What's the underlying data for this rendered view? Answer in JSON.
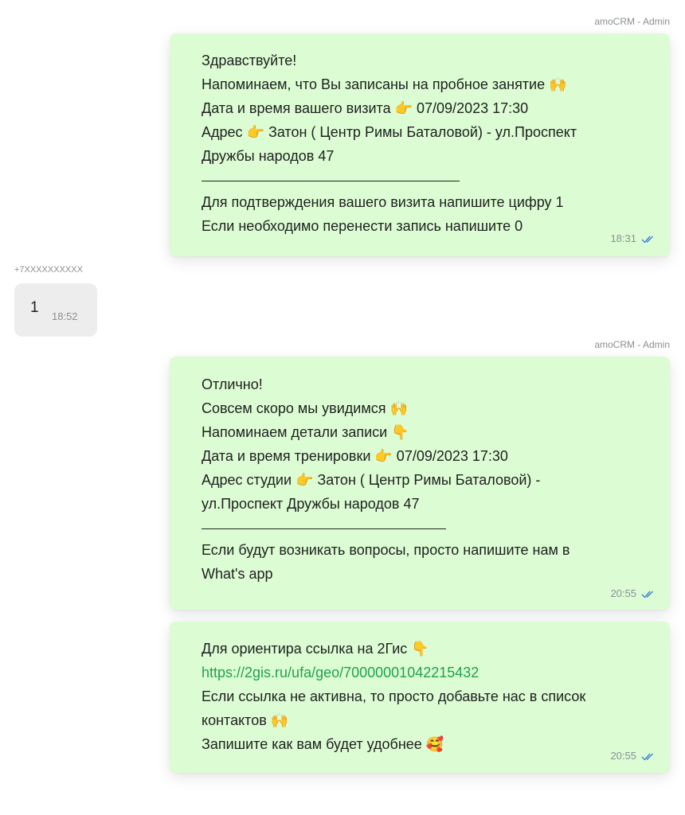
{
  "messages": [
    {
      "sender": "amoCRM - Admin",
      "time": "18:31",
      "lines": {
        "l1": "Здравствуйте!",
        "l2": "Напоминаем, что Вы записаны на пробное занятие 🙌",
        "l3": "Дата и время вашего визита 👉 07/09/2023 17:30",
        "l4": "Адрес 👉 Затон ( Центр Римы Баталовой) - ул.Проспект",
        "l5": "Дружбы народов 47",
        "l6": "Для подтверждения вашего визита напишите цифру 1",
        "l7": "Если необходимо перенести запись напишите 0"
      }
    },
    {
      "sender": "+7XXXXXXXXXX",
      "text": "1",
      "time": "18:52"
    },
    {
      "sender": "amoCRM - Admin",
      "time": "20:55",
      "lines": {
        "l1": "Отлично!",
        "l2": "Совсем скоро мы увидимся 🙌",
        "l3": "Напоминаем детали записи 👇",
        "l4": "Дата и время тренировки 👉 07/09/2023 17:30",
        "l5": "Адрес студии 👉 Затон ( Центр Римы Баталовой) -",
        "l6": "ул.Проспект Дружбы народов 47",
        "l7": "Если будут возникать вопросы, просто напишите нам в",
        "l8": "What's app"
      }
    },
    {
      "time": "20:55",
      "lines": {
        "l1": "Для ориентира ссылка на 2Гис 👇",
        "link": "https://2gis.ru/ufa/geo/70000001042215432",
        "l2": "Если ссылка не активна, то просто добавьте нас в список",
        "l3": "контактов 🙌",
        "l4": "Запишите как вам будет удобнее 🥰"
      }
    }
  ],
  "colors": {
    "outgoing_bubble": "#dcfdd4",
    "incoming_bubble": "#ededed",
    "link": "#21a04a",
    "read_ticks": "#3b7fd4"
  },
  "icons": {
    "read_receipt": "double-check-icon"
  }
}
